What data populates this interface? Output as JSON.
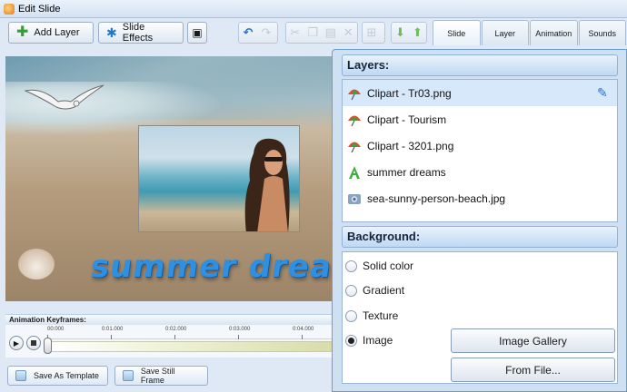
{
  "window": {
    "title": "Edit Slide"
  },
  "toolbar": {
    "add_layer_label": "Add Layer",
    "slide_effects_label": "Slide Effects"
  },
  "tabs": [
    {
      "label": "Slide",
      "active": true
    },
    {
      "label": "Layer",
      "active": false
    },
    {
      "label": "Animation",
      "active": false
    },
    {
      "label": "Sounds",
      "active": false
    }
  ],
  "preview": {
    "overlay_text": "summer dreams"
  },
  "keyframes": {
    "header": "Animation Keyframes:",
    "ticks": [
      "00:000",
      "0:01.000",
      "0:02.000",
      "0:03.000",
      "0:04.000"
    ]
  },
  "bottom": {
    "save_template_label": "Save As Template",
    "save_still_label": "Save Still Frame"
  },
  "layers": {
    "header": "Layers:",
    "items": [
      {
        "label": "Clipart - Tr03.png",
        "icon": "umbrella-icon",
        "selected": true
      },
      {
        "label": "Clipart - Tourism",
        "icon": "umbrella-icon",
        "selected": false
      },
      {
        "label": "Clipart - 3201.png",
        "icon": "umbrella-icon",
        "selected": false
      },
      {
        "label": "summer dreams",
        "icon": "text-icon",
        "selected": false
      },
      {
        "label": "sea-sunny-person-beach.jpg",
        "icon": "image-icon",
        "selected": false
      }
    ]
  },
  "background": {
    "header": "Background:",
    "options": [
      {
        "label": "Solid color",
        "checked": false
      },
      {
        "label": "Gradient",
        "checked": false
      },
      {
        "label": "Texture",
        "checked": false
      },
      {
        "label": "Image",
        "checked": true
      }
    ],
    "image_gallery_label": "Image Gallery",
    "from_file_label": "From File..."
  }
}
